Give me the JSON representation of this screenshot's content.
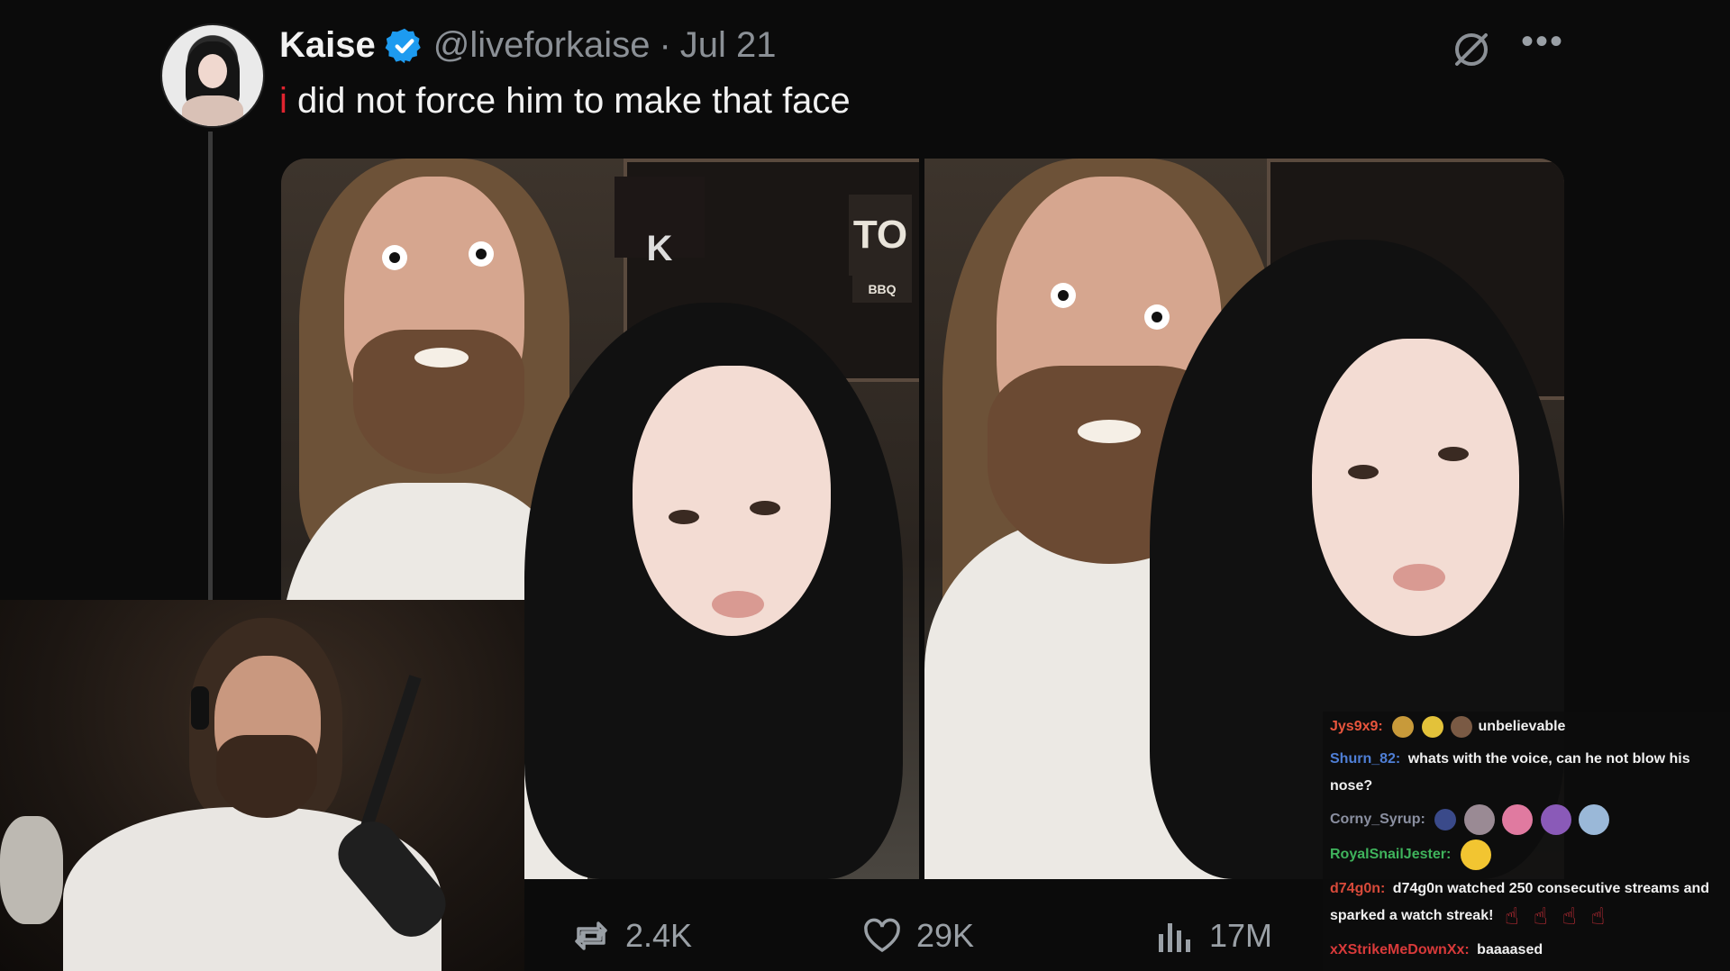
{
  "tweet": {
    "author_name": "Kaise",
    "handle": "@liveforkaise",
    "separator": "·",
    "date": "Jul 21",
    "text_mark": "i",
    "text": "did not force him to make that face",
    "more_label": "•••"
  },
  "photo_text": {
    "sign_a": "K",
    "sign_b": "TO",
    "sign_c": "BBQ"
  },
  "actions": {
    "reposts": "2.4K",
    "likes": "29K",
    "views": "17M"
  },
  "chat": {
    "messages": [
      {
        "user": "Jys9x9:",
        "color": "#e8553d",
        "text": "unbelievable"
      },
      {
        "user": "Shurn_82:",
        "color": "#4f7fd6",
        "text": "whats with the voice, can he not blow his nose?"
      },
      {
        "user": "Corny_Syrup:",
        "color": "#8a8fa0",
        "text": ""
      },
      {
        "user": "RoyalSnailJester:",
        "color": "#3fb35c",
        "text": ""
      },
      {
        "user": "d74g0n:",
        "color": "#d84a3a",
        "text": "d74g0n watched 250 consecutive streams and sparked a watch streak!"
      },
      {
        "user": "xXStrikeMeDownXx:",
        "color": "#d93a3a",
        "text": "baaaased"
      }
    ]
  }
}
